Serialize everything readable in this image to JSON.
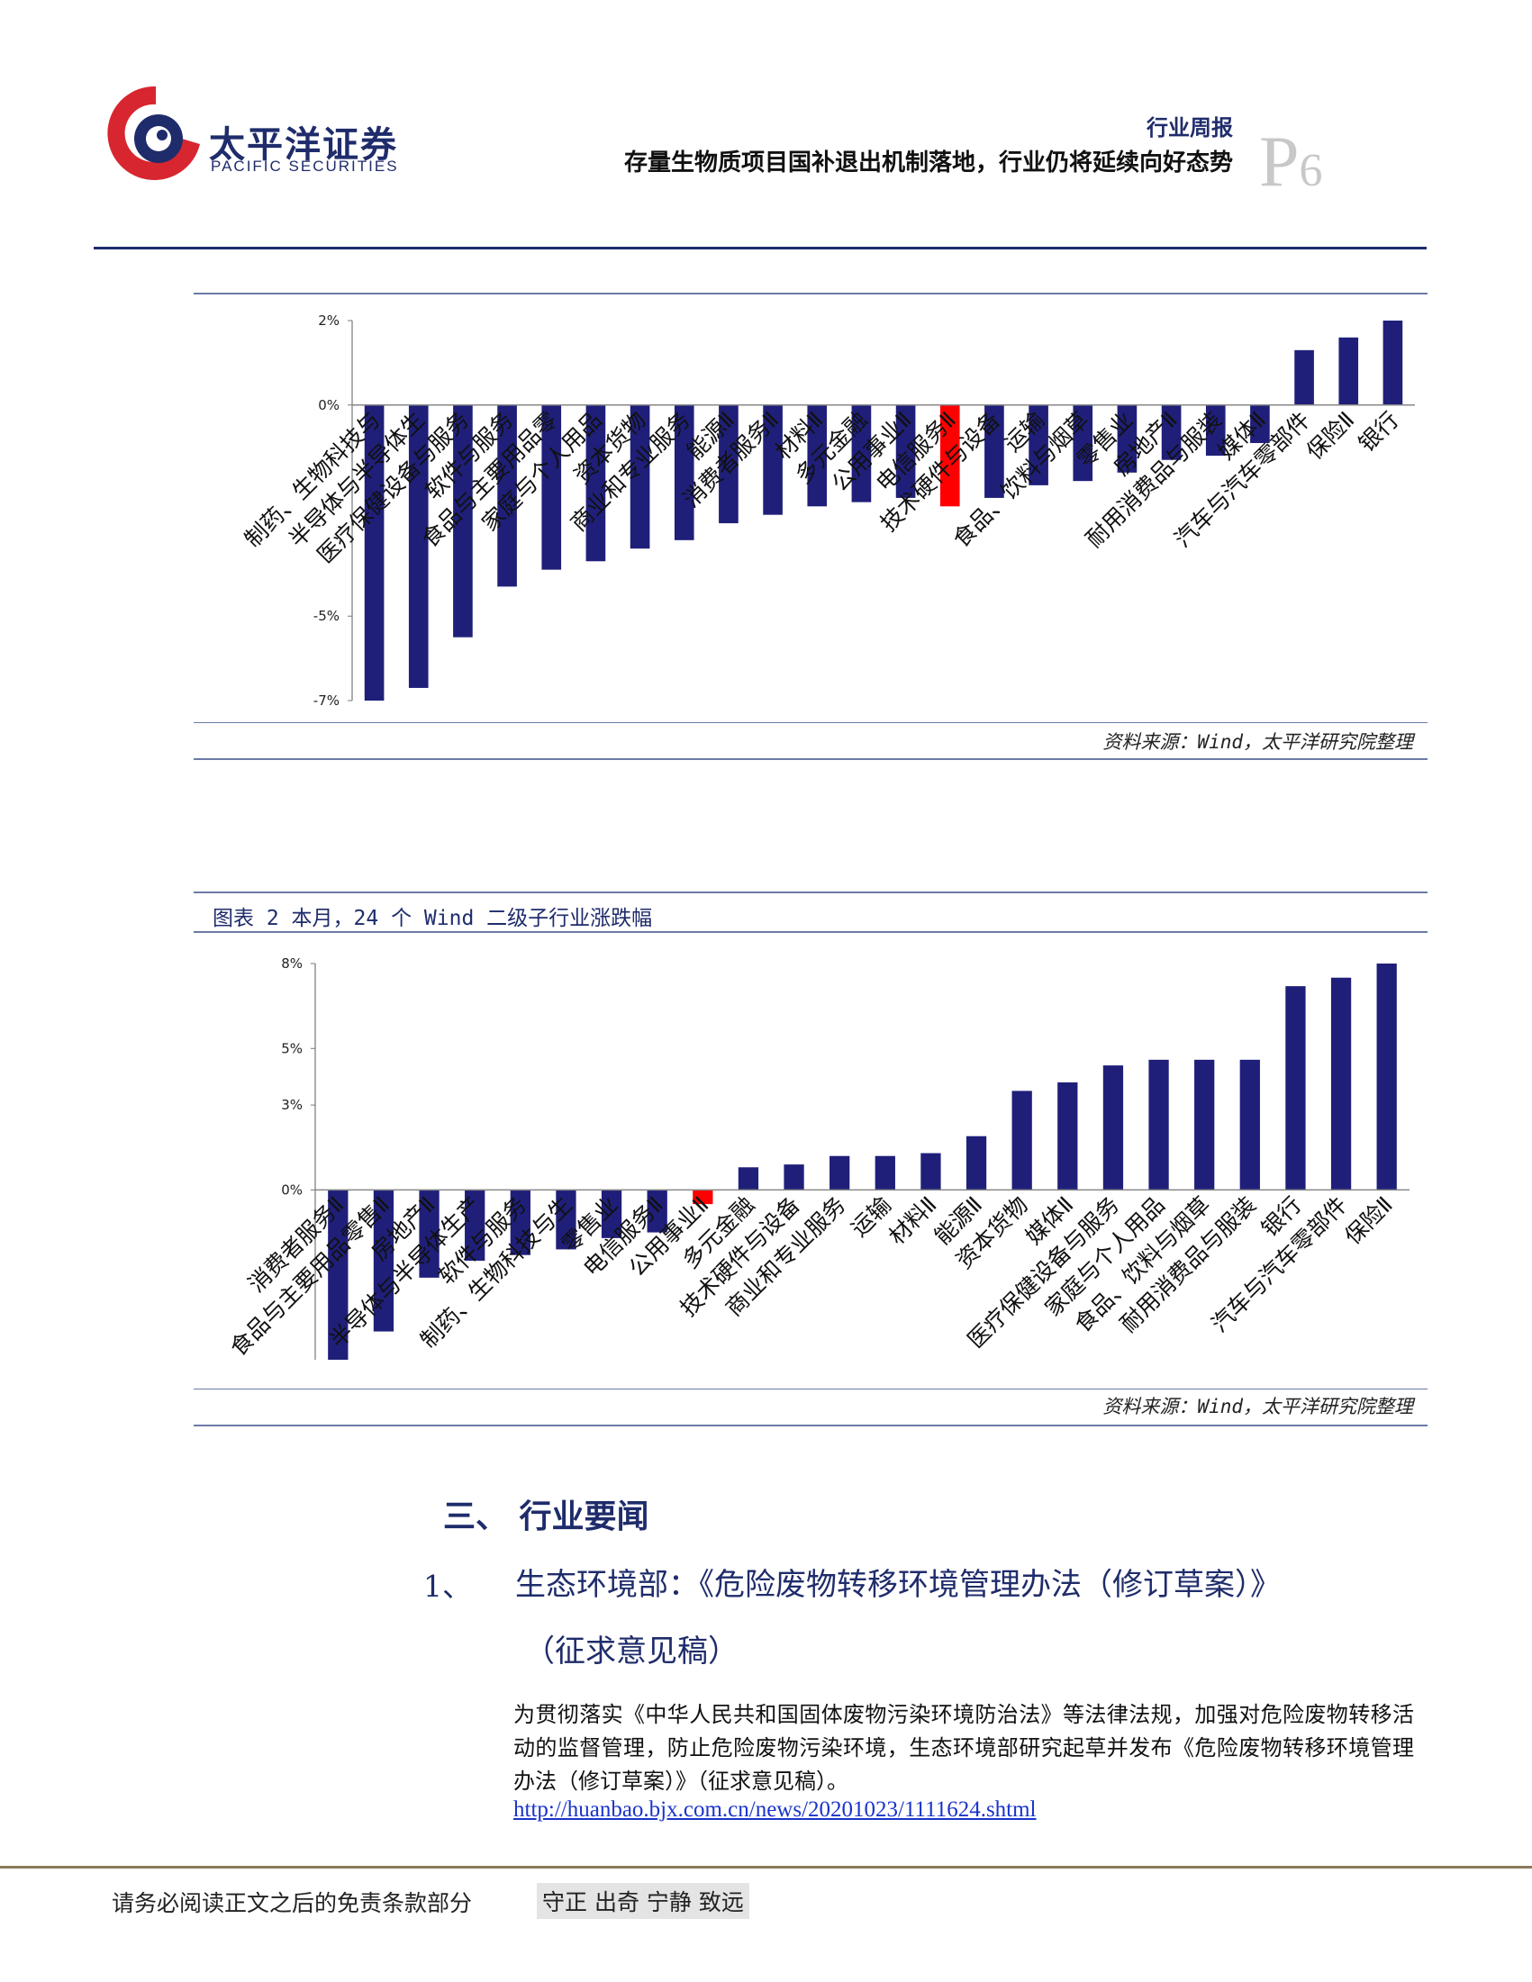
{
  "header": {
    "company_name": "太平洋证券",
    "company_name_en": "PACIFIC SECURITIES",
    "report_type": "行业周报",
    "report_title": "存量生物质项目国补退出机制落地，行业仍将延续向好态势",
    "page_prefix": "P",
    "page_number": "6"
  },
  "colors": {
    "brand_navy": "#1f2c6b",
    "bar_navy": "#1f1f7a",
    "highlight_red": "#ff0000",
    "logo_red": "#d7262f"
  },
  "chart1": {
    "source": "资料来源：Wind，太平洋研究院整理"
  },
  "chart2": {
    "caption": "图表 2 本月，24 个 Wind 二级子行业涨跌幅",
    "source": "资料来源：Wind，太平洋研究院整理"
  },
  "chart_data": [
    {
      "type": "bar",
      "title": "",
      "ylim": [
        -7,
        2
      ],
      "yticks": [
        "2%",
        "0%",
        "-5%",
        "-7%"
      ],
      "ytick_values": [
        2,
        0,
        -5,
        -7
      ],
      "highlight_category": "电信服务Ⅱ",
      "categories": [
        "制药、生物科技与",
        "半导体与半导体生",
        "医疗保健设备与服务",
        "软件与服务",
        "食品与主要用品零",
        "家庭与个人用品",
        "资本货物",
        "商业和专业服务",
        "能源Ⅱ",
        "消费者服务Ⅱ",
        "材料Ⅱ",
        "多元金融",
        "公用事业Ⅱ",
        "电信服务Ⅱ",
        "技术硬件与设备",
        "运输",
        "食品、饮料与烟草",
        "零售业",
        "房地产Ⅱ",
        "耐用消费品与服装",
        "媒体Ⅱ",
        "汽车与汽车零部件",
        "保险Ⅱ",
        "银行"
      ],
      "values": [
        -7.0,
        -6.7,
        -5.5,
        -4.3,
        -3.9,
        -3.7,
        -3.4,
        -3.2,
        -2.8,
        -2.6,
        -2.4,
        -2.3,
        -2.2,
        -2.4,
        -2.2,
        -1.9,
        -1.8,
        -1.6,
        -1.3,
        -1.2,
        -0.9,
        1.3,
        1.6,
        2.0
      ]
    },
    {
      "type": "bar",
      "title": "",
      "ylim": [
        -6,
        8
      ],
      "yticks": [
        "8%",
        "5%",
        "3%",
        "0%"
      ],
      "ytick_values": [
        8,
        5,
        3,
        0
      ],
      "highlight_category": "公用事业Ⅱ",
      "categories": [
        "消费者服务Ⅱ",
        "食品与主要用品零售Ⅱ",
        "房地产Ⅱ",
        "半导体与半导体生产",
        "软件与服务",
        "制药、生物科技与生",
        "零售业",
        "电信服务Ⅱ",
        "公用事业Ⅱ",
        "多元金融",
        "技术硬件与设备",
        "商业和专业服务",
        "运输",
        "材料Ⅱ",
        "能源Ⅱ",
        "资本货物",
        "媒体Ⅱ",
        "医疗保健设备与服务",
        "家庭与个人用品",
        "食品、饮料与烟草",
        "耐用消费品与服装",
        "银行",
        "汽车与汽车零部件",
        "保险Ⅱ"
      ],
      "values": [
        -6.0,
        -5.0,
        -3.1,
        -2.5,
        -2.3,
        -2.1,
        -1.7,
        -1.5,
        -0.5,
        0.8,
        0.9,
        1.2,
        1.2,
        1.3,
        1.9,
        3.5,
        3.8,
        4.4,
        4.6,
        4.6,
        4.6,
        7.2,
        7.5,
        8.0
      ]
    }
  ],
  "section": {
    "title": "三、 行业要闻"
  },
  "news": {
    "number": "1、",
    "title_line1": "生态环境部：《危险废物转移环境管理办法（修订草案）》",
    "title_line2": "（征求意见稿）",
    "body": "为贯彻落实《中华人民共和国固体废物污染环境防治法》等法律法规，加强对危险废物转移活动的监督管理，防止危险废物污染环境，生态环境部研究起草并发布《危险废物转移环境管理办法（修订草案）》（征求意见稿）。",
    "link": "http://huanbao.bjx.com.cn/news/20201023/1111624.shtml"
  },
  "footer": {
    "disclaimer": "请务必阅读正文之后的免责条款部分",
    "motto": "守正 出奇 宁静 致远"
  }
}
